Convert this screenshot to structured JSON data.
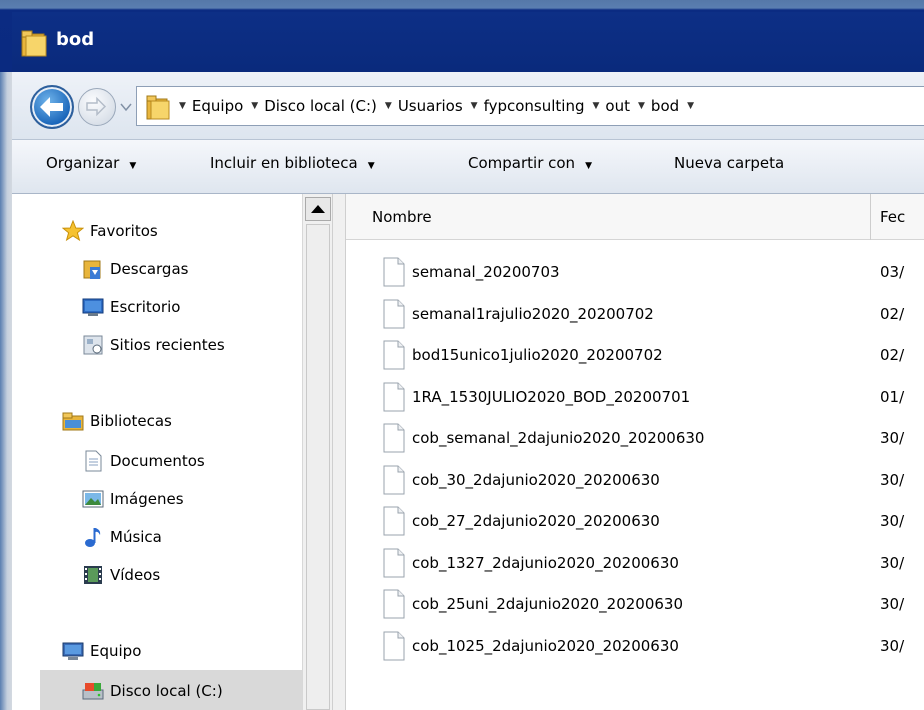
{
  "window": {
    "title": "bod"
  },
  "address": {
    "crumbs": [
      "Equipo",
      "Disco local (C:)",
      "Usuarios",
      "fypconsulting",
      "out",
      "bod"
    ]
  },
  "toolbar": {
    "organize": "Organizar",
    "include_library": "Incluir en biblioteca",
    "share_with": "Compartir con",
    "new_folder": "Nueva carpeta"
  },
  "nav": {
    "favorites": "Favoritos",
    "downloads": "Descargas",
    "desktop": "Escritorio",
    "recent": "Sitios recientes",
    "libraries": "Bibliotecas",
    "documents": "Documentos",
    "images": "Imágenes",
    "music": "Música",
    "videos": "Vídeos",
    "computer": "Equipo",
    "local_disk": "Disco local (C:)"
  },
  "columns": {
    "name": "Nombre",
    "date": "Fec"
  },
  "files": [
    {
      "name": "semanal_20200703",
      "date": "03/"
    },
    {
      "name": "semanal1rajulio2020_20200702",
      "date": "02/"
    },
    {
      "name": "bod15unico1julio2020_20200702",
      "date": "02/"
    },
    {
      "name": "1RA_1530JULIO2020_BOD_20200701",
      "date": "01/"
    },
    {
      "name": "cob_semanal_2dajunio2020_20200630",
      "date": "30/"
    },
    {
      "name": "cob_30_2dajunio2020_20200630",
      "date": "30/"
    },
    {
      "name": "cob_27_2dajunio2020_20200630",
      "date": "30/"
    },
    {
      "name": "cob_1327_2dajunio2020_20200630",
      "date": "30/"
    },
    {
      "name": "cob_25uni_2dajunio2020_20200630",
      "date": "30/"
    },
    {
      "name": "cob_1025_2dajunio2020_20200630",
      "date": "30/"
    }
  ],
  "colors": {
    "title_bar": "#0a2a80",
    "selected": "#d9d9d9"
  }
}
